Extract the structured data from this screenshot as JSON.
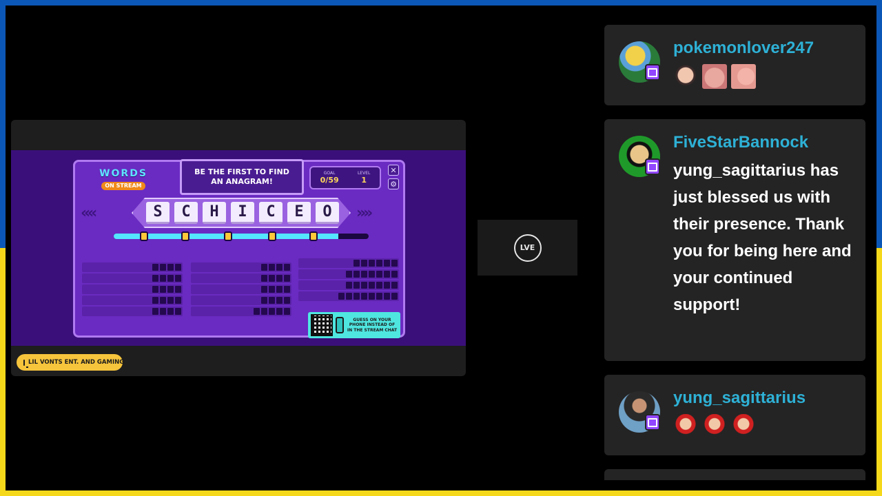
{
  "game": {
    "logo_line1": "WORDS",
    "logo_line2": "ON STREAM",
    "banner": "BE THE FIRST TO FIND AN ANAGRAM!",
    "goal_caption": "GOAL",
    "goal_value": "0/59",
    "level_caption": "LEVEL",
    "level_value": "1",
    "letters": [
      "S",
      "C",
      "H",
      "I",
      "C",
      "E",
      "O"
    ],
    "progress_fraction": 0.88,
    "qr_text": "GUESS ON YOUR PHONE INSTEAD OF IN THE STREAM CHAT",
    "icons": {
      "close": "close-icon",
      "settings": "gear-icon",
      "lock": "lock-icon",
      "phone": "phone-icon"
    }
  },
  "channel": {
    "name": "LIL VONTS ENT. AND GAMING",
    "icon": "monitor-icon"
  },
  "live": {
    "label": "LVE"
  },
  "chat": [
    {
      "username": "pokemonlover247",
      "message": "",
      "emotes": [
        "face-emote",
        "glasses-emote",
        "nose-emote"
      ]
    },
    {
      "username": "FiveStarBannock",
      "message": "yung_sagittarius has just blessed us with their presence. Thank you for being here and your continued support!",
      "emotes": []
    },
    {
      "username": "yung_sagittarius",
      "message": "",
      "emotes": [
        "heart-character-emote",
        "heart-character-emote",
        "heart-character-emote"
      ]
    }
  ],
  "colors": {
    "username": "#2eb1d6",
    "twitch": "#9146ff",
    "card_bg": "#242424",
    "border_top": "#0b57b8",
    "border_bottom": "#f5d81a"
  }
}
